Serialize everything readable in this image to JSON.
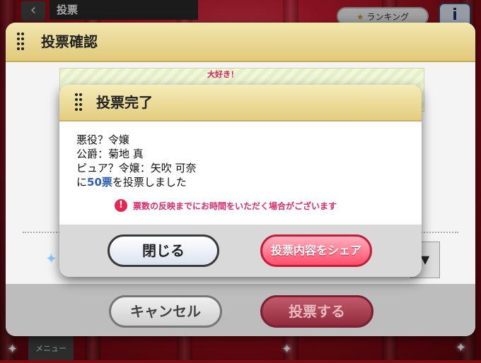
{
  "topbar": {
    "back_icon": "chevron-left-icon",
    "title": "投票",
    "ranking_label": "ランキング",
    "info_symbol": "i",
    "menu_label": "メニュー"
  },
  "confirm_dialog": {
    "title": "投票確認",
    "banner_tag": "大好き！",
    "select_arrow": "▼",
    "cancel_label": "キャンセル",
    "vote_label": "投票する"
  },
  "complete_dialog": {
    "title": "投票完了",
    "lines": [
      "悪役？令嬢",
      "公爵：菊地 真",
      "ピュア？令嬢：矢吹 可奈"
    ],
    "result_prefix": "に",
    "vote_count": "50票",
    "result_suffix": "を投票しました",
    "warning_icon": "!",
    "warning_text": "票数の反映までにお時間をいただく場合がございます",
    "close_label": "閉じる",
    "share_label": "投票内容をシェア"
  },
  "colors": {
    "header_gold": "#e3cd7f",
    "vote_count_blue": "#2d5fb3",
    "warning_pink": "#e02a6a",
    "share_button": "#ff4f6a"
  }
}
